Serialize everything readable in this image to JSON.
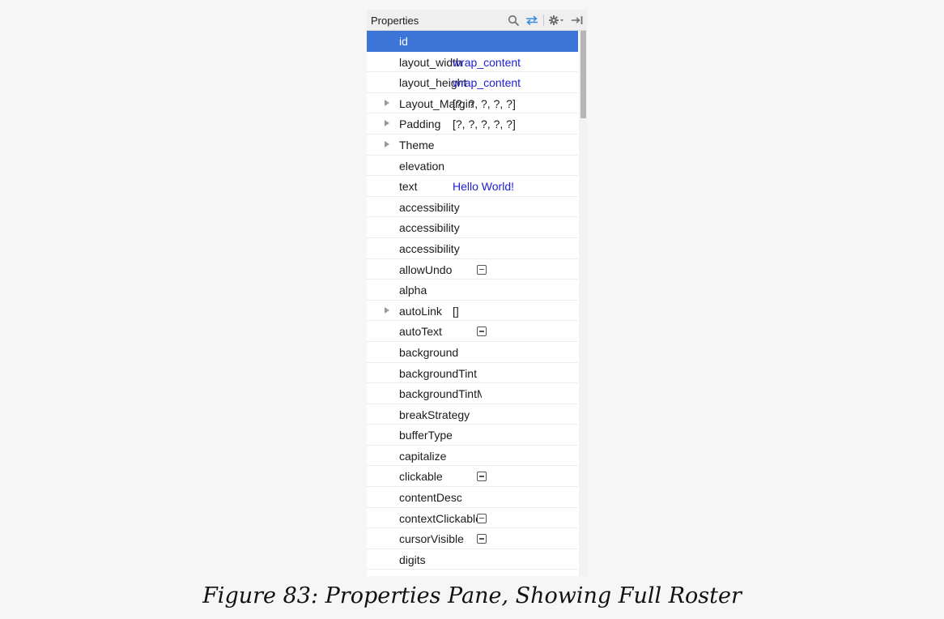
{
  "pane": {
    "title": "Properties",
    "toolbar_icons": [
      "search-icon",
      "swap-arrows-icon",
      "gear-icon",
      "hide-pane-icon"
    ]
  },
  "properties": [
    {
      "name": "id",
      "value": "",
      "kind": "text",
      "selected": true
    },
    {
      "name": "layout_width",
      "value": "wrap_content",
      "kind": "link"
    },
    {
      "name": "layout_height",
      "value": "wrap_content",
      "kind": "link"
    },
    {
      "name": "Layout_Margin",
      "value": "[?, ?, ?, ?, ?]",
      "kind": "text",
      "expandable": true
    },
    {
      "name": "Padding",
      "value": "[?, ?, ?, ?, ?]",
      "kind": "text",
      "expandable": true
    },
    {
      "name": "Theme",
      "value": "",
      "kind": "text",
      "expandable": true
    },
    {
      "name": "elevation",
      "value": "",
      "kind": "text"
    },
    {
      "name": "text",
      "value": "Hello World!",
      "kind": "link"
    },
    {
      "name": "accessibility",
      "value": "",
      "kind": "text"
    },
    {
      "name": "accessibility",
      "value": "",
      "kind": "text"
    },
    {
      "name": "accessibility",
      "value": "",
      "kind": "text"
    },
    {
      "name": "allowUndo",
      "value": "",
      "kind": "checkbox"
    },
    {
      "name": "alpha",
      "value": "",
      "kind": "text"
    },
    {
      "name": "autoLink",
      "value": "[]",
      "kind": "text",
      "expandable": true
    },
    {
      "name": "autoText",
      "value": "",
      "kind": "checkbox"
    },
    {
      "name": "background",
      "value": "",
      "kind": "text"
    },
    {
      "name": "backgroundTint",
      "value": "",
      "kind": "text"
    },
    {
      "name": "backgroundTintMode",
      "value": "",
      "kind": "text"
    },
    {
      "name": "breakStrategy",
      "value": "",
      "kind": "text"
    },
    {
      "name": "bufferType",
      "value": "",
      "kind": "text"
    },
    {
      "name": "capitalize",
      "value": "",
      "kind": "text"
    },
    {
      "name": "clickable",
      "value": "",
      "kind": "checkbox"
    },
    {
      "name": "contentDesc",
      "value": "",
      "kind": "text"
    },
    {
      "name": "contextClickable",
      "value": "",
      "kind": "checkbox"
    },
    {
      "name": "cursorVisible",
      "value": "",
      "kind": "checkbox"
    },
    {
      "name": "digits",
      "value": "",
      "kind": "text"
    }
  ],
  "caption": "Figure 83: Properties Pane, Showing Full Roster",
  "colors": {
    "selection": "#3c74d7",
    "link_value": "#2020d0",
    "background": "#f6f6f6"
  }
}
